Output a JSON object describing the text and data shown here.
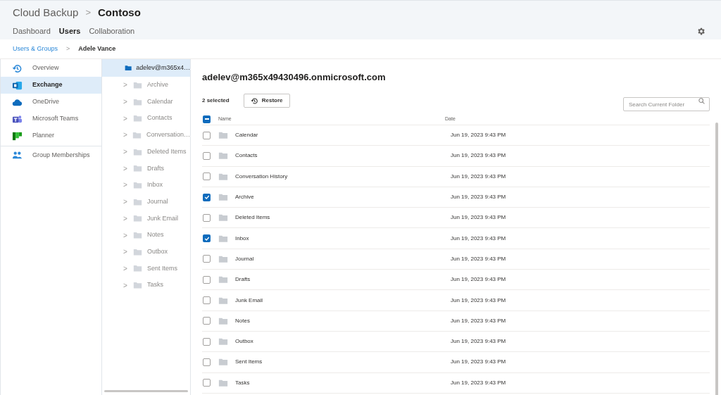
{
  "header": {
    "app": "Cloud Backup",
    "separator": ">",
    "tenant": "Contoso"
  },
  "tabs": [
    {
      "label": "Dashboard",
      "selected": false
    },
    {
      "label": "Users",
      "selected": true
    },
    {
      "label": "Collaboration",
      "selected": false
    }
  ],
  "breadcrumb": {
    "parent": "Users & Groups",
    "separator": ">",
    "current": "Adele Vance"
  },
  "sidebar": {
    "items": [
      {
        "label": "Overview",
        "selected": false
      },
      {
        "label": "Exchange",
        "selected": true
      },
      {
        "label": "OneDrive",
        "selected": false
      },
      {
        "label": "Microsoft Teams",
        "selected": false
      },
      {
        "label": "Planner",
        "selected": false
      }
    ],
    "footer_item": {
      "label": "Group Memberships",
      "selected": false
    }
  },
  "tree": {
    "root": {
      "label": "adelev@m365x4…",
      "selected": true
    },
    "children": [
      {
        "label": "Archive",
        "expander": ">"
      },
      {
        "label": "Calendar",
        "expander": ">"
      },
      {
        "label": "Contacts",
        "expander": ">"
      },
      {
        "label": "Conversation…",
        "expander": ">"
      },
      {
        "label": "Deleted Items",
        "expander": ">"
      },
      {
        "label": "Drafts",
        "expander": ">"
      },
      {
        "label": "Inbox",
        "expander": ">"
      },
      {
        "label": "Journal",
        "expander": ">"
      },
      {
        "label": "Junk Email",
        "expander": ">"
      },
      {
        "label": "Notes",
        "expander": ">"
      },
      {
        "label": "Outbox",
        "expander": ">"
      },
      {
        "label": "Sent Items",
        "expander": ">"
      },
      {
        "label": "Tasks",
        "expander": ">"
      }
    ]
  },
  "main": {
    "title": "adelev@m365x49430496.onmicrosoft.com",
    "selection_count": "2 selected",
    "restore_button": "Restore",
    "search": {
      "placeholder": "Search Current Folder"
    }
  },
  "table": {
    "select_all": {
      "indeterminate": true
    },
    "columns": [
      "Name",
      "Date"
    ],
    "rows": [
      {
        "name": "Calendar",
        "date": "Jun 19, 2023 9:43 PM",
        "checked": false
      },
      {
        "name": "Contacts",
        "date": "Jun 19, 2023 9:43 PM",
        "checked": false
      },
      {
        "name": "Conversation History",
        "date": "Jun 19, 2023 9:43 PM",
        "checked": false
      },
      {
        "name": "Archive",
        "date": "Jun 19, 2023 9:43 PM",
        "checked": true
      },
      {
        "name": "Deleted Items",
        "date": "Jun 19, 2023 9:43 PM",
        "checked": false
      },
      {
        "name": "Inbox",
        "date": "Jun 19, 2023 9:43 PM",
        "checked": true
      },
      {
        "name": "Journal",
        "date": "Jun 19, 2023 9:43 PM",
        "checked": false
      },
      {
        "name": "Drafts",
        "date": "Jun 19, 2023 9:43 PM",
        "checked": false
      },
      {
        "name": "Junk Email",
        "date": "Jun 19, 2023 9:43 PM",
        "checked": false
      },
      {
        "name": "Notes",
        "date": "Jun 19, 2023 9:43 PM",
        "checked": false
      },
      {
        "name": "Outbox",
        "date": "Jun 19, 2023 9:43 PM",
        "checked": false
      },
      {
        "name": "Sent Items",
        "date": "Jun 19, 2023 9:43 PM",
        "checked": false
      },
      {
        "name": "Tasks",
        "date": "Jun 19, 2023 9:43 PM",
        "checked": false
      }
    ]
  }
}
